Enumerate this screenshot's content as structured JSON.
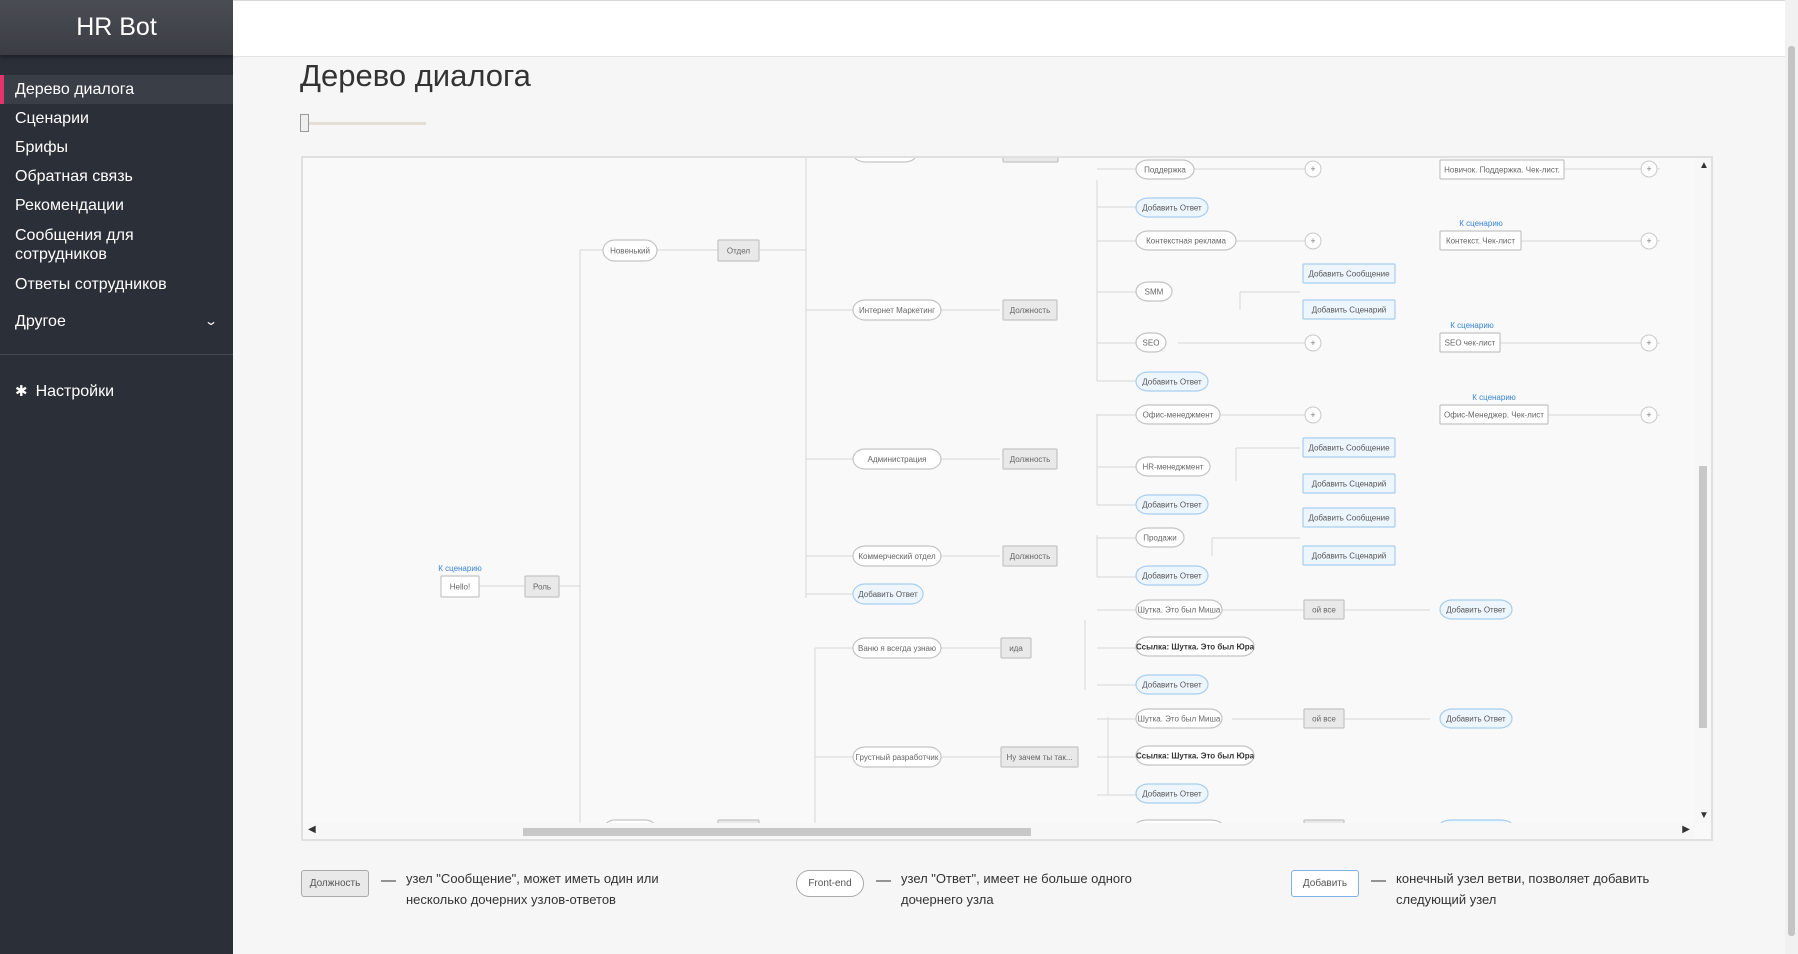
{
  "brand": "HR Bot",
  "nav": {
    "items": [
      "Дерево диалога",
      "Сценарии",
      "Брифы",
      "Обратная связь",
      "Рекомендации",
      "Сообщения для сотрудников",
      "Ответы сотрудников"
    ],
    "other": "Другое",
    "settings": "Настройки"
  },
  "page_title": "Дерево диалога",
  "tree": {
    "root": {
      "label": "Hello!",
      "link": "К сценарию"
    },
    "role": "Роль",
    "novice": "Новенький",
    "dept": "Отдел",
    "branches": [
      {
        "label": "Интернет Маркетинг",
        "msg": "Должность"
      },
      {
        "label": "Администрация",
        "msg": "Должность"
      },
      {
        "label": "Коммерческий отдел",
        "msg": "Должность"
      },
      {
        "label": "Добавить Ответ",
        "msg": ""
      },
      {
        "label": "Ваню я всегда узнаю",
        "msg": "ида"
      },
      {
        "label": "Грустный разработчик",
        "msg": "Ну зачем ты так..."
      }
    ],
    "leaves": [
      "Поддержка",
      "Добавить Ответ",
      "Контекстная реклама",
      "SMM",
      "SEO",
      "Добавить Ответ",
      "Офис-менеджмент",
      "HR-менеджмент",
      "Добавить Ответ",
      "Продажи",
      "Добавить Ответ",
      "Шутка. Это был Миша",
      "Ссылка: Шутка. Это был Юра",
      "Добавить Ответ",
      "Шутка. Это был Миша",
      "Ссылка: Шутка. Это был Юра",
      "Добавить Ответ"
    ],
    "add_message": "Добавить Сообщение",
    "add_scenario": "Добавить Сценарий",
    "to_scenario": "К сценарию",
    "plus": "+",
    "oy_vse": "ой все",
    "checklists": [
      "Новичок. Поддержка. Чек-лист.",
      "Контекст. Чек-лист",
      "SEO чек-лист",
      "Офис-Менеджер. Чек-лист"
    ],
    "add_answer": "Добавить Ответ"
  },
  "legend": [
    {
      "sample": "Должность",
      "text": "узел \"Сообщение\", может иметь один или несколько дочерних узлов-ответов"
    },
    {
      "sample": "Front-end",
      "text": "узел \"Ответ\", имеет не больше одного дочернего узла"
    },
    {
      "sample": "Добавить",
      "text": "конечный узел ветви, позволяет добавить следующий узел"
    }
  ]
}
